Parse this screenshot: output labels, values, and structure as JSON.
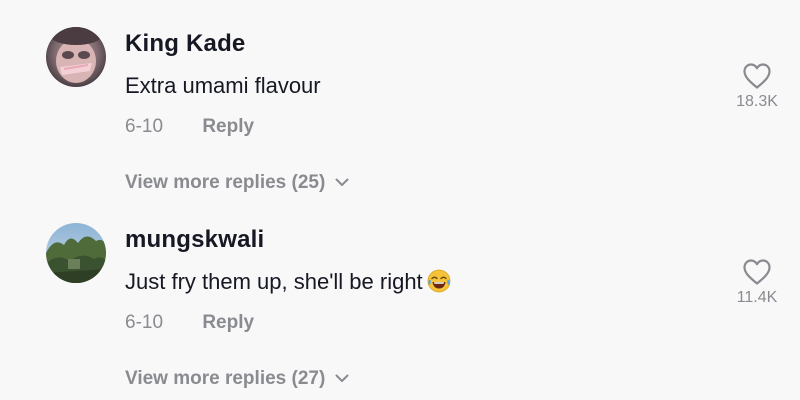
{
  "comments": [
    {
      "username": "King Kade",
      "text": "Extra umami flavour",
      "emoji": "",
      "date": "6-10",
      "reply_label": "Reply",
      "likes": "18.3K",
      "view_replies": "View more replies (25)",
      "avatar_icon": "avatar-photo"
    },
    {
      "username": "mungskwali",
      "text": "Just fry them up, she'll be right",
      "emoji": "😂",
      "date": "6-10",
      "reply_label": "Reply",
      "likes": "11.4K",
      "view_replies": "View more replies (27)",
      "avatar_icon": "avatar-photo"
    }
  ],
  "icons": {
    "like": "heart-outline-icon",
    "expand": "chevron-down-icon",
    "emoji": "face-with-tears-of-joy-icon"
  },
  "colors": {
    "background": "#f8f8f8",
    "primary_text": "#161823",
    "secondary_text": "#8a8b91"
  }
}
